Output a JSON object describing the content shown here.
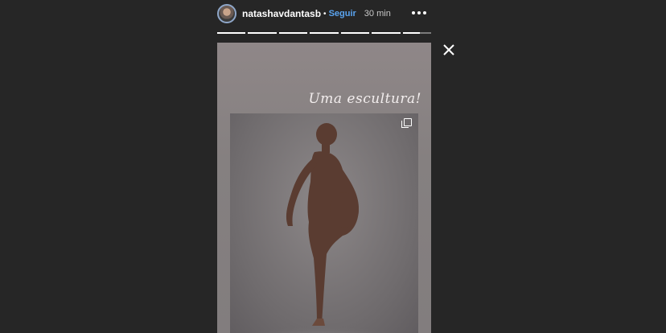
{
  "header": {
    "username": "natashavdantasb",
    "separator": "•",
    "follow_label": "Seguir",
    "timestamp": "30 min"
  },
  "progress": {
    "segments_total": 7,
    "segments_viewed": 6,
    "current_progress": 0.6
  },
  "story": {
    "caption": "Uma escultura!"
  },
  "icons": {
    "more": "more-options-icon",
    "close": "close-icon",
    "copy": "multiple-posts-icon"
  }
}
